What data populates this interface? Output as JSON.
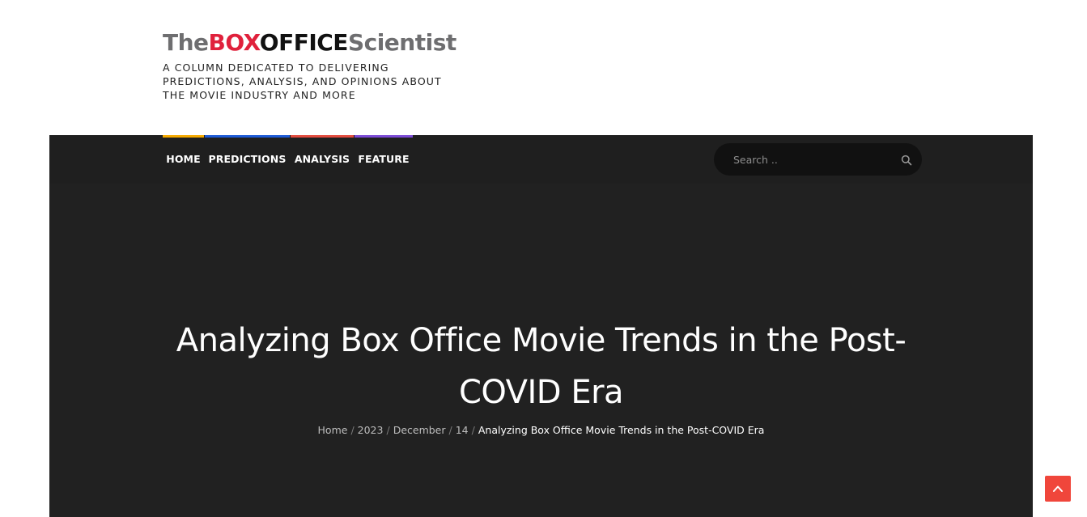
{
  "site": {
    "logo": {
      "part1": "The",
      "part2": "BOX",
      "part3": "OFFICE",
      "part4": "Scientist"
    },
    "tagline": [
      "A COLUMN DEDICATED TO DELIVERING",
      "PREDICTIONS, ANALYSIS, AND OPINIONS ABOUT",
      "THE MOVIE INDUSTRY AND MORE"
    ]
  },
  "nav": {
    "items": [
      {
        "label": "HOME",
        "accent": "#f5a900"
      },
      {
        "label": "PREDICTIONS",
        "accent": "#1e5bd6"
      },
      {
        "label": "ANALYSIS",
        "accent": "#e24c3f"
      },
      {
        "label": "FEATURE",
        "accent": "#7c4bd6"
      }
    ]
  },
  "search": {
    "placeholder": "Search ..",
    "icon": "search-icon"
  },
  "article": {
    "title": "Analyzing Box Office Movie Trends in the Post-COVID Era"
  },
  "breadcrumb": {
    "items": [
      "Home",
      "2023",
      "December",
      "14"
    ],
    "separator": "/",
    "current": "Analyzing Box Office Movie Trends in the Post-COVID Era"
  },
  "back_to_top": {
    "icon": "chevron-up-icon",
    "color": "#f0463b"
  },
  "colors": {
    "hero_bg": "#212121",
    "brand_red": "#e0213c"
  }
}
